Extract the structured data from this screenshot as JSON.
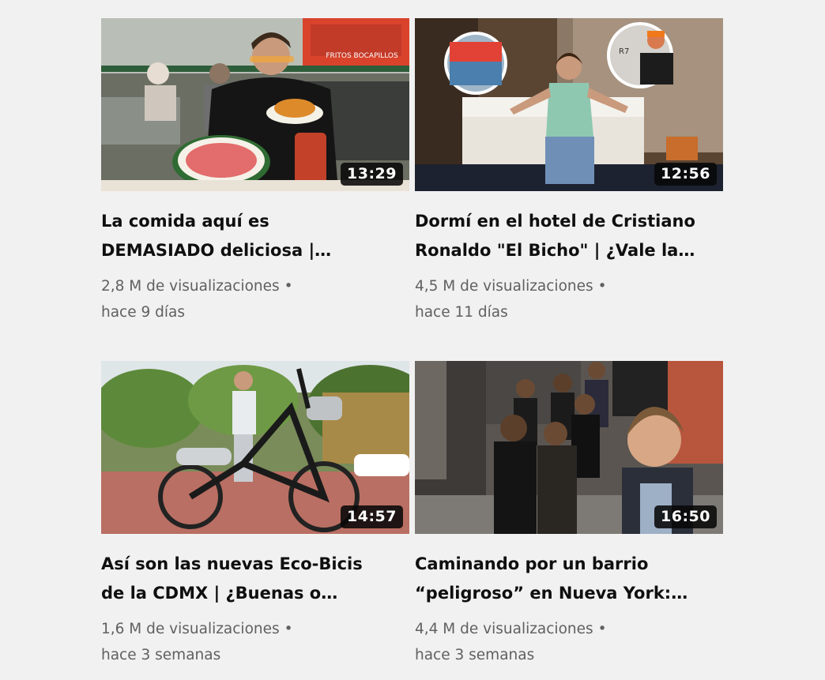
{
  "videos": [
    {
      "title_line1": "La comida aquí es",
      "title_line2": "DEMASIADO deliciosa |…",
      "duration": "13:29",
      "views": "2,8 M de visualizaciones",
      "separator": "•",
      "age": "hace 9 días",
      "thumbnail_sign": "FRITOS BOCAPILLOS"
    },
    {
      "title_line1": "Dormí en el hotel de Cristiano",
      "title_line2": "Ronaldo \"El Bicho\" | ¿Vale la…",
      "duration": "12:56",
      "views": "4,5 M de visualizaciones",
      "separator": "•",
      "age": "hace 11 días",
      "thumbnail_sign": "R7"
    },
    {
      "title_line1": "Así son las nuevas Eco-Bicis",
      "title_line2": "de la CDMX | ¿Buenas o…",
      "duration": "14:57",
      "views": "1,6 M de visualizaciones",
      "separator": "•",
      "age": "hace 3 semanas"
    },
    {
      "title_line1": "Caminando por un barrio",
      "title_line2": "“peligroso” en Nueva York:…",
      "duration": "16:50",
      "views": "4,4 M de visualizaciones",
      "separator": "•",
      "age": "hace 3 semanas"
    }
  ]
}
